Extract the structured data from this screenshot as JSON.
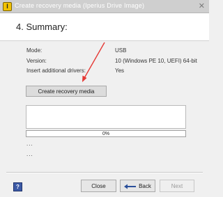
{
  "window": {
    "title": "Create recovery media (Iperius Drive Image)",
    "app_icon_glyph": "I",
    "close_glyph": "✕"
  },
  "header": {
    "title": "4. Summary:"
  },
  "summary": {
    "rows": [
      {
        "label": "Mode:",
        "value": "USB"
      },
      {
        "label": "Version:",
        "value": "10 (Windows PE 10, UEFI) 64-bit"
      },
      {
        "label": "Insert additional drivers:",
        "value": "Yes"
      }
    ]
  },
  "create_button": {
    "label": "Create recovery media"
  },
  "progress": {
    "percent": 0,
    "label": "0%"
  },
  "log_lines": [
    "...",
    "..."
  ],
  "footer": {
    "help_label": "?",
    "close_label": "Close",
    "back_label": "Back",
    "next_label": "Next"
  },
  "colors": {
    "annotation_arrow": "#e53935",
    "progress_fill": "#06b025",
    "help_icon": "#3c5aa6",
    "app_icon": "#f2c200"
  },
  "icons": {
    "app": "app-icon",
    "close": "close-icon",
    "help": "help-icon",
    "back": "back-arrow-icon",
    "annotation": "red-arrow-annotation"
  }
}
